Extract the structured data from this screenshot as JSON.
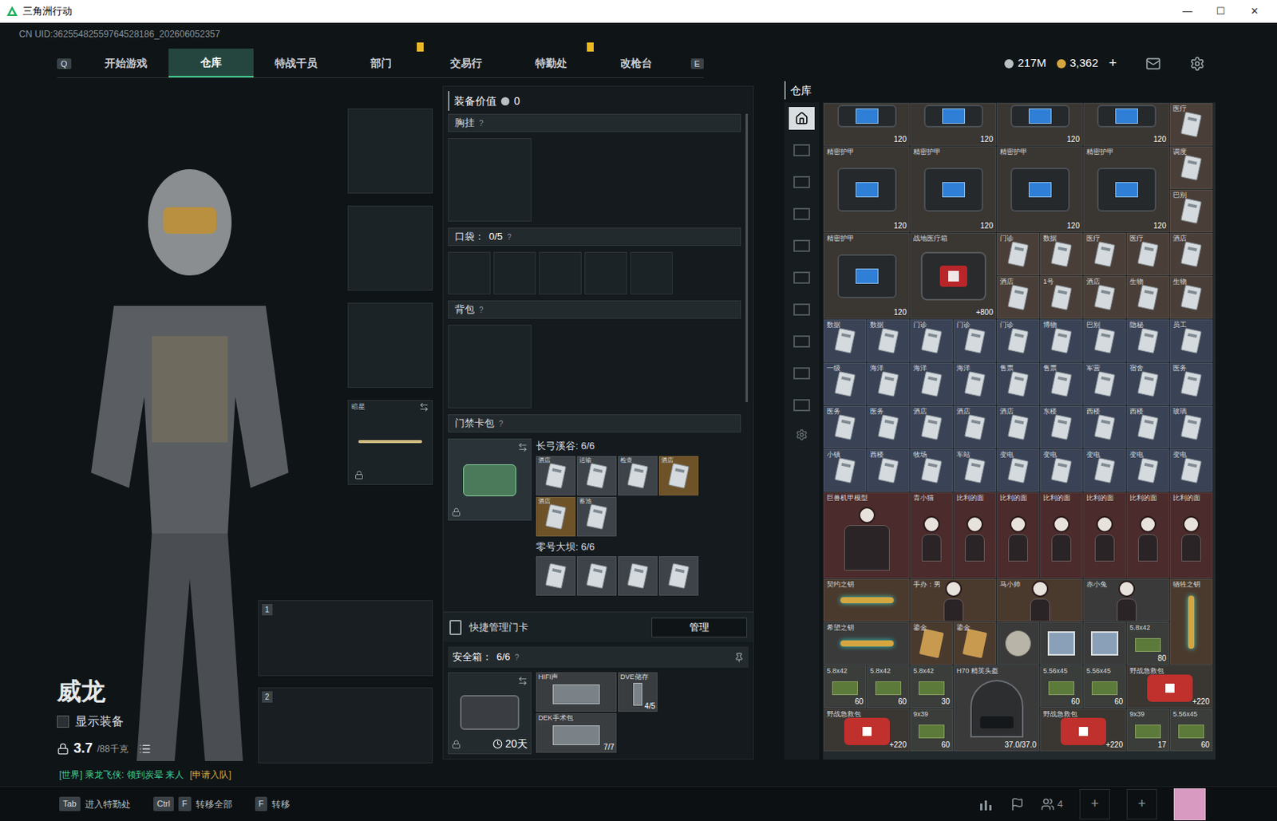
{
  "window": {
    "title": "三角洲行动",
    "controls": [
      "—",
      "☐",
      "✕"
    ]
  },
  "uid": "CN UID:36255482559764528186_202606052357",
  "nav": {
    "left_key": "Q",
    "right_key": "E",
    "tabs": [
      {
        "label": "开始游戏",
        "selected": false,
        "alert": false
      },
      {
        "label": "仓库",
        "selected": true,
        "alert": false
      },
      {
        "label": "特战干员",
        "selected": false,
        "alert": false
      },
      {
        "label": "部门",
        "selected": false,
        "alert": true
      },
      {
        "label": "交易行",
        "selected": false,
        "alert": false
      },
      {
        "label": "特勤处",
        "selected": false,
        "alert": true
      },
      {
        "label": "改枪台",
        "selected": false,
        "alert": false
      }
    ]
  },
  "currency": [
    {
      "amount": "217M",
      "kind": "coin"
    },
    {
      "amount": "3,362",
      "kind": "gold"
    }
  ],
  "currency_add": "+",
  "character": {
    "name": "威龙",
    "show_equipment_label": "显示装备",
    "show_equipment": false,
    "weight": "3.7",
    "capacity": "/88千克",
    "chat": "[世界] 乘龙飞侠: 领到炭晕 来人",
    "chat_action": "[申请入队]"
  },
  "slots": {
    "melee_label": "暗星",
    "weapons": [
      "1",
      "2"
    ]
  },
  "loadout": {
    "value_label": "装备价值",
    "value": "0",
    "help": "?",
    "chest_label": "胸挂",
    "pocket_label": "口袋：",
    "pocket_count": "0/5",
    "pockets": 5,
    "backpack_label": "背包",
    "cardpack_label": "门禁卡包",
    "maps": [
      {
        "title": "长弓溪谷: 6/6",
        "cards": [
          {
            "name": "酒店",
            "color": "#3d4349"
          },
          {
            "name": "运输",
            "color": "#3d4349"
          },
          {
            "name": "检查",
            "color": "#3d4349"
          },
          {
            "name": "酒店",
            "color": "#6e5228"
          },
          {
            "name": "酒店",
            "color": "#6e5228"
          },
          {
            "name": "蓄池",
            "color": "#3d4349"
          }
        ]
      },
      {
        "title": "零号大坝: 6/6",
        "cards": [
          {
            "name": "",
            "color": "#3d4349"
          },
          {
            "name": "",
            "color": "#3d4349"
          },
          {
            "name": "",
            "color": "#3d4349"
          },
          {
            "name": "",
            "color": "#3d4349"
          }
        ]
      }
    ],
    "quick_manage_label": "快捷管理门卡",
    "manage_button": "管理",
    "safe_label": "安全箱：",
    "safe_count": "6/6",
    "safe_days": "20天",
    "safe_items": [
      {
        "name": "HIFI声",
        "count": "",
        "kind": "wide"
      },
      {
        "name": "DVE储存",
        "count": "4/5",
        "kind": "single"
      },
      {
        "name": "DEK手术包",
        "count": "7/7",
        "kind": "wide"
      }
    ]
  },
  "warehouse": {
    "title": "仓库",
    "categories": [
      {
        "selected": true
      },
      {
        "selected": false
      },
      {
        "selected": false
      },
      {
        "selected": false
      },
      {
        "selected": false
      },
      {
        "selected": false
      },
      {
        "selected": false
      },
      {
        "selected": false
      },
      {
        "selected": false
      },
      {
        "selected": false
      }
    ],
    "items": [
      {
        "kind": "armor_cut",
        "count": "120",
        "color": "#3a3632"
      },
      {
        "kind": "armor_cut",
        "count": "120",
        "color": "#3a3632"
      },
      {
        "kind": "armor_cut",
        "count": "120",
        "color": "#3a3632"
      },
      {
        "kind": "armor_cut",
        "count": "120",
        "color": "#3a3632"
      },
      {
        "kind": "card",
        "name": "医疗",
        "color": "#4a3f38"
      },
      {
        "kind": "armor",
        "name": "精密护甲",
        "count": "120",
        "color": "#3a3632"
      },
      {
        "kind": "armor",
        "name": "精密护甲",
        "count": "120",
        "color": "#3a3632"
      },
      {
        "kind": "armor",
        "name": "精密护甲",
        "count": "120",
        "color": "#3a3632"
      },
      {
        "kind": "armor",
        "name": "精密护甲",
        "count": "120",
        "color": "#3a3632"
      },
      {
        "kind": "card",
        "name": "调度",
        "color": "#4a3f38"
      },
      {
        "kind": "card",
        "name": "巴别",
        "color": "#4a3f38"
      },
      {
        "kind": "armor",
        "name": "精密护甲",
        "count": "120",
        "color": "#3a3632"
      },
      {
        "kind": "medkit",
        "name": "战地医疗箱",
        "count": "+800",
        "color": "#3a3632"
      },
      {
        "kind": "card",
        "name": "门诊",
        "color": "#4a3f38"
      },
      {
        "kind": "card",
        "name": "数据",
        "color": "#4a3f38"
      },
      {
        "kind": "card",
        "name": "医疗",
        "color": "#4a3f38"
      },
      {
        "kind": "card",
        "name": "医疗",
        "color": "#4a3f38"
      },
      {
        "kind": "card",
        "name": "酒店",
        "color": "#4a3f38"
      },
      {
        "kind": "card",
        "name": "酒店",
        "color": "#4a3f38"
      },
      {
        "kind": "card",
        "name": "1号",
        "color": "#4a3f38"
      },
      {
        "kind": "card",
        "name": "酒店",
        "color": "#4a3f38"
      },
      {
        "kind": "card",
        "name": "生物",
        "color": "#4a3f38"
      },
      {
        "kind": "card",
        "name": "生物",
        "color": "#4a3f38"
      },
      {
        "kind": "card",
        "name": "数据",
        "color": "#3a4356"
      },
      {
        "kind": "card",
        "name": "数据",
        "color": "#3a4356"
      },
      {
        "kind": "card",
        "name": "门诊",
        "color": "#3a4356"
      },
      {
        "kind": "card",
        "name": "门诊",
        "color": "#3a4356"
      },
      {
        "kind": "card",
        "name": "门诊",
        "color": "#3a4356"
      },
      {
        "kind": "card",
        "name": "博物",
        "color": "#3a4356"
      },
      {
        "kind": "card",
        "name": "巴别",
        "color": "#3a4356"
      },
      {
        "kind": "card",
        "name": "隐秘",
        "color": "#3a4356"
      },
      {
        "kind": "card",
        "name": "员工",
        "color": "#3a4356"
      },
      {
        "kind": "card",
        "name": "一级",
        "color": "#3a4356"
      },
      {
        "kind": "card",
        "name": "海洋",
        "color": "#3a4356"
      },
      {
        "kind": "card",
        "name": "海洋",
        "color": "#3a4356"
      },
      {
        "kind": "card",
        "name": "海洋",
        "color": "#3a4356"
      },
      {
        "kind": "card",
        "name": "售票",
        "color": "#3a4356"
      },
      {
        "kind": "card",
        "name": "售票",
        "color": "#3a4356"
      },
      {
        "kind": "card",
        "name": "军营",
        "color": "#3a4356"
      },
      {
        "kind": "card",
        "name": "宿舍",
        "color": "#3a4356"
      },
      {
        "kind": "card",
        "name": "医务",
        "color": "#3a4356"
      },
      {
        "kind": "card",
        "name": "医务",
        "color": "#3a4356"
      },
      {
        "kind": "card",
        "name": "医务",
        "color": "#3a4356"
      },
      {
        "kind": "card",
        "name": "酒店",
        "color": "#3a4356"
      },
      {
        "kind": "card",
        "name": "酒店",
        "color": "#3a4356"
      },
      {
        "kind": "card",
        "name": "酒店",
        "color": "#3a4356"
      },
      {
        "kind": "card",
        "name": "东楼",
        "color": "#3a4356"
      },
      {
        "kind": "card",
        "name": "西楼",
        "color": "#3a4356"
      },
      {
        "kind": "card",
        "name": "西楼",
        "color": "#3a4356"
      },
      {
        "kind": "card",
        "name": "玻璃",
        "color": "#3a4356"
      },
      {
        "kind": "card",
        "name": "小镇",
        "color": "#3a4356"
      },
      {
        "kind": "card",
        "name": "西楼",
        "color": "#3a4356"
      },
      {
        "kind": "card",
        "name": "牧场",
        "color": "#3a4356"
      },
      {
        "kind": "card",
        "name": "车站",
        "color": "#3a4356"
      },
      {
        "kind": "card",
        "name": "变电",
        "color": "#3a4356"
      },
      {
        "kind": "card",
        "name": "变电",
        "color": "#3a4356"
      },
      {
        "kind": "card",
        "name": "变电",
        "color": "#3a4356"
      },
      {
        "kind": "card",
        "name": "变电",
        "color": "#3a4356"
      },
      {
        "kind": "card",
        "name": "变电",
        "color": "#3a4356"
      },
      {
        "kind": "figure_large",
        "name": "巨兽机甲模型",
        "color": "#4b2b2b"
      },
      {
        "kind": "figure",
        "name": "青小猫",
        "color": "#4b2b2b"
      },
      {
        "kind": "figure",
        "name": "比利的面",
        "color": "#4b2b2b"
      },
      {
        "kind": "figure",
        "name": "比利的面",
        "color": "#4b2b2b"
      },
      {
        "kind": "figure",
        "name": "比利的面",
        "color": "#4b2b2b"
      },
      {
        "kind": "figure",
        "name": "比利的面",
        "color": "#4b2b2b"
      },
      {
        "kind": "figure",
        "name": "比利的面",
        "color": "#4b2b2b"
      },
      {
        "kind": "figure",
        "name": "比利的面",
        "color": "#4b2b2b"
      },
      {
        "kind": "key_wide",
        "name": "契约之钥",
        "color": "#4a3a2e"
      },
      {
        "kind": "figure_wide",
        "name": "手办：男",
        "color": "#4a3a2e"
      },
      {
        "kind": "figure_wide",
        "name": "马小帅",
        "color": "#4a3a2e"
      },
      {
        "kind": "figure_wide",
        "name": "赤小兔",
        "color": "#3a3a3a"
      },
      {
        "kind": "key_tall",
        "name": "牺牲之钥",
        "color": "#4a3a2e"
      },
      {
        "kind": "key_wide",
        "name": "希望之钥",
        "color": "#3a3a3a"
      },
      {
        "kind": "item",
        "name": "鎏金",
        "color": "#4a3a2e"
      },
      {
        "kind": "item",
        "name": "鎏金",
        "color": "#4a3a2e"
      },
      {
        "kind": "orb",
        "color": "#3a3a3a"
      },
      {
        "kind": "photo",
        "color": "#3a3a3a"
      },
      {
        "kind": "photo",
        "color": "#3a3a3a"
      },
      {
        "kind": "ammo",
        "name": "5.8x42",
        "count": "80",
        "color": "#3a3d3a"
      },
      {
        "kind": "ammo",
        "name": "5.8x42",
        "count": "60",
        "color": "#3a3d3a"
      },
      {
        "kind": "ammo",
        "name": "5.8x42",
        "count": "60",
        "color": "#3a3d3a"
      },
      {
        "kind": "ammo",
        "name": "5.8x42",
        "count": "30",
        "color": "#3a3d3a"
      },
      {
        "kind": "helmet",
        "name": "H70 精英头盔",
        "count": "37.0/37.0",
        "color": "#3a3a3a"
      },
      {
        "kind": "ammo",
        "name": "5.56x45",
        "count": "60",
        "color": "#3a3d3a"
      },
      {
        "kind": "ammo",
        "name": "5.56x45",
        "count": "60",
        "color": "#3a3d3a"
      },
      {
        "kind": "firstaid",
        "name": "野战急救包",
        "count": "+220",
        "color": "#3a3632"
      },
      {
        "kind": "firstaid",
        "name": "野战急救包",
        "count": "+220",
        "color": "#3a3632"
      },
      {
        "kind": "ammo",
        "name": "9x39",
        "count": "60",
        "color": "#3a3d3a"
      },
      {
        "kind": "firstaid",
        "name": "野战急救包",
        "count": "+220",
        "color": "#3a3632"
      },
      {
        "kind": "ammo",
        "name": "9x39",
        "count": "17",
        "color": "#3a3d3a"
      },
      {
        "kind": "ammo",
        "name": "5.56x45",
        "count": "60",
        "color": "#3a3d3a"
      }
    ]
  },
  "bottom_bar": {
    "hints": [
      {
        "keys": [
          "Tab"
        ],
        "label": "进入特勤处"
      },
      {
        "keys": [
          "Ctrl",
          "F"
        ],
        "label": "转移全部"
      },
      {
        "keys": [
          "F"
        ],
        "label": "转移"
      }
    ],
    "squad_count": "4",
    "add_slots": [
      "+",
      "+"
    ]
  }
}
